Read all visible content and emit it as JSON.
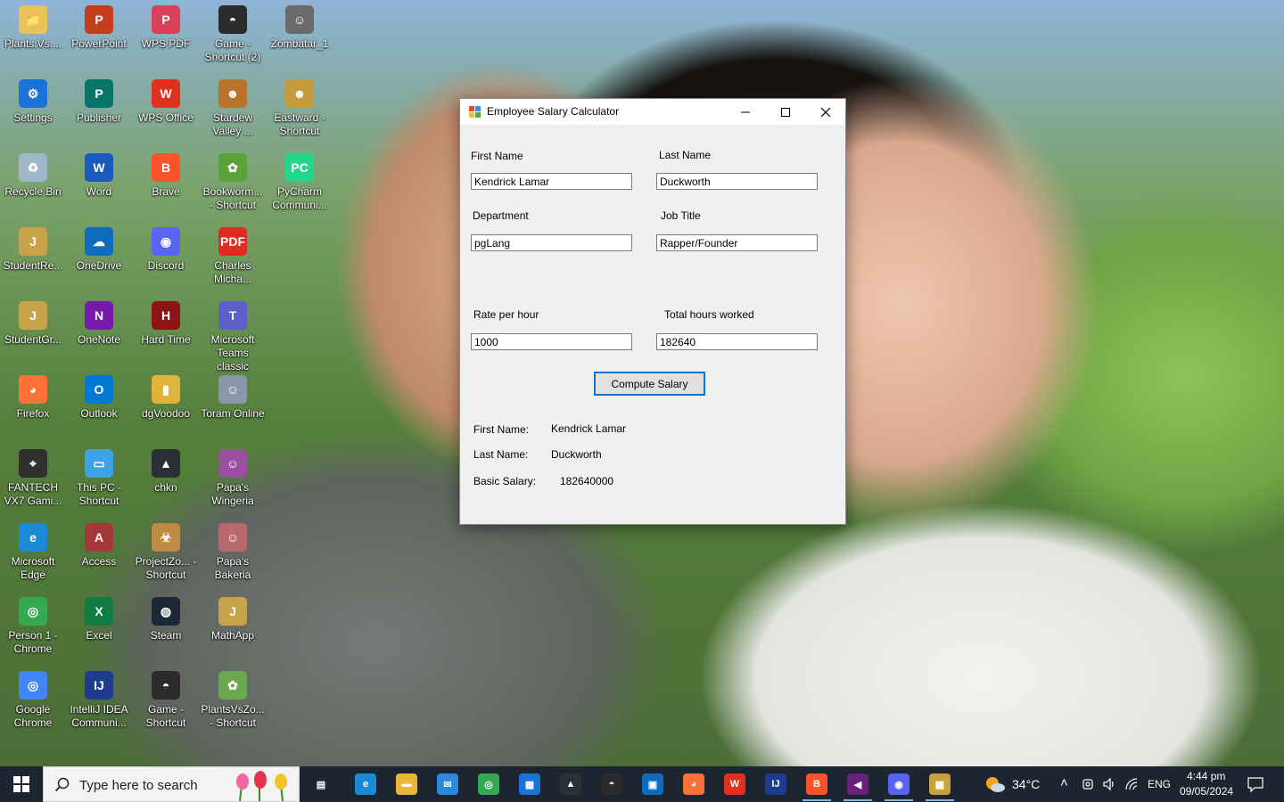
{
  "desktop": {
    "icons": [
      {
        "label": "Plants.Vs....",
        "color": "#e8c25a",
        "glyph": "📁"
      },
      {
        "label": "PowerPoint",
        "color": "#c43e1c",
        "glyph": "P"
      },
      {
        "label": "WPS PDF",
        "color": "#d9415b",
        "glyph": "P"
      },
      {
        "label": "Game - Shortcut (2)",
        "color": "#2b2b2b",
        "glyph": "◓"
      },
      {
        "label": "Zombatar_1",
        "color": "#6a6a6a",
        "glyph": "☺"
      },
      {
        "label": "Settings",
        "color": "#1a73d9",
        "glyph": "⚙"
      },
      {
        "label": "Publisher",
        "color": "#077568",
        "glyph": "P"
      },
      {
        "label": "WPS Office",
        "color": "#e0311f",
        "glyph": "W"
      },
      {
        "label": "Stardew Valley ...",
        "color": "#b8742a",
        "glyph": "☻"
      },
      {
        "label": "Eastward - Shortcut",
        "color": "#c49a3a",
        "glyph": "☻"
      },
      {
        "label": "Recycle Bin",
        "color": "#9fb7c9",
        "glyph": "♻"
      },
      {
        "label": "Word",
        "color": "#185abd",
        "glyph": "W"
      },
      {
        "label": "Brave",
        "color": "#fb542b",
        "glyph": "B"
      },
      {
        "label": "Bookworm... - Shortcut",
        "color": "#5aa33a",
        "glyph": "✿"
      },
      {
        "label": "PyCharm Communi...",
        "color": "#21d789",
        "glyph": "PC"
      },
      {
        "label": "StudentRe...",
        "color": "#c8a34a",
        "glyph": "J"
      },
      {
        "label": "OneDrive",
        "color": "#0f6cbd",
        "glyph": "☁"
      },
      {
        "label": "Discord",
        "color": "#5865f2",
        "glyph": "◉"
      },
      {
        "label": "Charles Micha...",
        "color": "#e02b20",
        "glyph": "PDF"
      },
      {
        "label": "StudentGr...",
        "color": "#c8a34a",
        "glyph": "J"
      },
      {
        "label": "OneNote",
        "color": "#7719aa",
        "glyph": "N"
      },
      {
        "label": "Hard Time",
        "color": "#8c1414",
        "glyph": "H"
      },
      {
        "label": "Microsoft Teams classic",
        "color": "#5b5fc7",
        "glyph": "T"
      },
      {
        "label": "Firefox",
        "color": "#ff7139",
        "glyph": "◕"
      },
      {
        "label": "Outlook",
        "color": "#0078d4",
        "glyph": "O"
      },
      {
        "label": "dgVoodoo",
        "color": "#e0b43a",
        "glyph": "▮"
      },
      {
        "label": "Toram Online",
        "color": "#8a97a8",
        "glyph": "☺"
      },
      {
        "label": "FANTECH VX7 Gami...",
        "color": "#303030",
        "glyph": "⌖"
      },
      {
        "label": "This PC - Shortcut",
        "color": "#3ba2e8",
        "glyph": "▭"
      },
      {
        "label": "chkn",
        "color": "#2a2f38",
        "glyph": "▲"
      },
      {
        "label": "Papa's Wingeria",
        "color": "#9a4fa0",
        "glyph": "☺"
      },
      {
        "label": "Microsoft Edge",
        "color": "#1a8ad4",
        "glyph": "e"
      },
      {
        "label": "Access",
        "color": "#a4373a",
        "glyph": "A"
      },
      {
        "label": "ProjectZo... - Shortcut",
        "color": "#c08a45",
        "glyph": "☣"
      },
      {
        "label": "Papa's Bakeria",
        "color": "#b86a6a",
        "glyph": "☺"
      },
      {
        "label": "Person 1 - Chrome",
        "color": "#34a853",
        "glyph": "◎"
      },
      {
        "label": "Excel",
        "color": "#107c41",
        "glyph": "X"
      },
      {
        "label": "Steam",
        "color": "#1b2838",
        "glyph": "◍"
      },
      {
        "label": "MathApp",
        "color": "#c8a34a",
        "glyph": "J"
      },
      {
        "label": "Google Chrome",
        "color": "#4285f4",
        "glyph": "◎"
      },
      {
        "label": "IntelliJ IDEA Communi...",
        "color": "#1d3b8f",
        "glyph": "IJ"
      },
      {
        "label": "Game - Shortcut",
        "color": "#2b2b2b",
        "glyph": "◓"
      },
      {
        "label": "PlantsVsZo... - Shortcut",
        "color": "#6aa84f",
        "glyph": "✿"
      }
    ]
  },
  "window": {
    "title": "Employee Salary Calculator",
    "labels": {
      "first_name": "First Name",
      "last_name": "Last Name",
      "department": "Department",
      "job_title": "Job Title",
      "rate_per_hour": "Rate per hour",
      "total_hours": "Total hours worked"
    },
    "values": {
      "first_name": "Kendrick Lamar",
      "last_name": "Duckworth",
      "department": "pgLang",
      "job_title": "Rapper/Founder",
      "rate_per_hour": "1000",
      "total_hours": "182640"
    },
    "compute_button": "Compute Salary",
    "result": {
      "first_name_label": "First Name:",
      "first_name_value": "Kendrick Lamar",
      "last_name_label": "Last Name:",
      "last_name_value": "Duckworth",
      "salary_label": "Basic Salary:",
      "salary_value": "182640000"
    }
  },
  "taskbar": {
    "search_placeholder": "Type here to search",
    "weather": "34°C",
    "language": "ENG",
    "time": "4:44 pm",
    "date": "09/05/2024",
    "apps": [
      {
        "name": "task-view",
        "color": "#1c2530",
        "glyph": "▤"
      },
      {
        "name": "edge",
        "color": "#1a8ad4",
        "glyph": "e"
      },
      {
        "name": "file-explorer",
        "color": "#e8b83a",
        "glyph": "▬"
      },
      {
        "name": "mail",
        "color": "#2a8ae0",
        "glyph": "✉"
      },
      {
        "name": "chrome",
        "color": "#34a853",
        "glyph": "◎"
      },
      {
        "name": "store",
        "color": "#1a73d9",
        "glyph": "▦"
      },
      {
        "name": "steam-chkn",
        "color": "#2a2f38",
        "glyph": "▲"
      },
      {
        "name": "game",
        "color": "#2b2b2b",
        "glyph": "◓"
      },
      {
        "name": "ms-store",
        "color": "#0f6cbd",
        "glyph": "▣"
      },
      {
        "name": "firefox",
        "color": "#ff7139",
        "glyph": "◕"
      },
      {
        "name": "wps",
        "color": "#e0311f",
        "glyph": "W"
      },
      {
        "name": "intellij",
        "color": "#1d3b8f",
        "glyph": "IJ"
      },
      {
        "name": "brave",
        "color": "#fb542b",
        "glyph": "B"
      },
      {
        "name": "visual-studio",
        "color": "#68217a",
        "glyph": "◀"
      },
      {
        "name": "discord",
        "color": "#5865f2",
        "glyph": "◉"
      },
      {
        "name": "salary-app",
        "color": "#c8a23a",
        "glyph": "▩"
      }
    ]
  }
}
